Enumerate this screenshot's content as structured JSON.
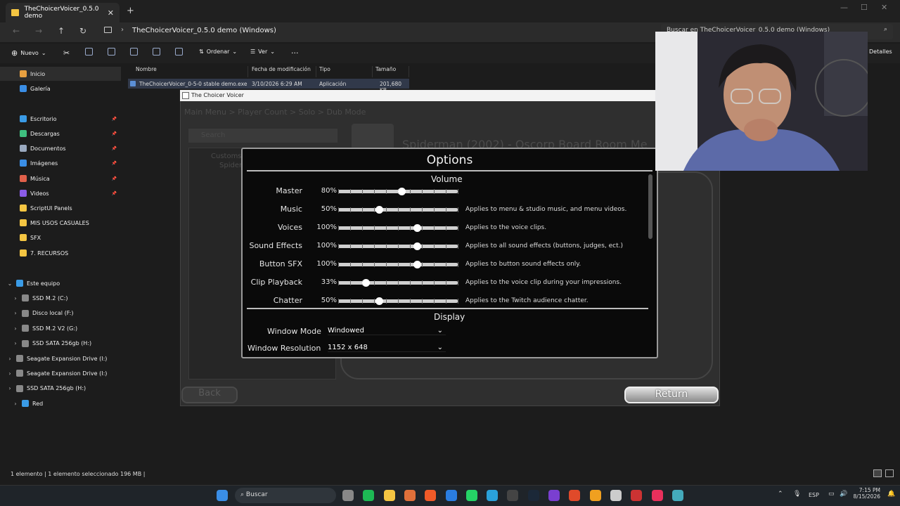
{
  "explorer": {
    "tab_title": "TheChoicerVoicer_0.5.0 demo",
    "breadcrumb": "TheChoicerVoicer_0.5.0 demo (Windows)",
    "search_placeholder": "Buscar en TheChoicerVoicer_0.5.0 demo (Windows)",
    "toolbar": {
      "new": "Nuevo",
      "sort": "Ordenar",
      "view": "Ver",
      "more": "···",
      "details": "Detalles"
    },
    "columns": [
      "Nombre",
      "Fecha de modificación",
      "Tipo",
      "Tamaño"
    ],
    "file": {
      "name": "TheChoicerVoicer_0-5-0 stable demo.exe",
      "date": "3/10/2026 6:29 AM",
      "type": "Aplicación",
      "size": "201,680 KB"
    },
    "sidebar": [
      {
        "label": "Inicio",
        "color": "#e8a040",
        "selected": true
      },
      {
        "label": "Galería",
        "color": "#3a8ee6"
      },
      {
        "label": "Escritorio",
        "color": "#3a9be6",
        "pin": true
      },
      {
        "label": "Descargas",
        "color": "#3fbf7f",
        "pin": true
      },
      {
        "label": "Documentos",
        "color": "#9aa9bf",
        "pin": true
      },
      {
        "label": "Imágenes",
        "color": "#3a8ee6",
        "pin": true
      },
      {
        "label": "Música",
        "color": "#e0604a",
        "pin": true
      },
      {
        "label": "Videos",
        "color": "#8a5be6",
        "pin": true
      },
      {
        "label": "ScriptUI Panels",
        "color": "#f4c542"
      },
      {
        "label": "MIS USOS CASUALES",
        "color": "#f4c542"
      },
      {
        "label": "SFX",
        "color": "#f4c542"
      },
      {
        "label": "7. RECURSOS",
        "color": "#f4c542"
      }
    ],
    "drives": [
      {
        "label": "Este equipo",
        "color": "#3a9be6",
        "expanded": true
      },
      {
        "label": "SSD M.2 (C:)",
        "color": "#888"
      },
      {
        "label": "Disco local (F:)",
        "color": "#888"
      },
      {
        "label": "SSD M.2 V2 (G:)",
        "color": "#888"
      },
      {
        "label": "SSD SATA 256gb (H:)",
        "color": "#888"
      },
      {
        "label": "Seagate Expansion Drive (I:)",
        "color": "#888"
      },
      {
        "label": "Seagate Expansion Drive (I:)",
        "color": "#888"
      },
      {
        "label": "SSD SATA 256gb (H:)",
        "color": "#888"
      },
      {
        "label": "Red",
        "color": "#3a9be6"
      }
    ],
    "status": "1 elemento    |  1 elemento seleccionado  196 MB  |"
  },
  "game": {
    "window_title": "The Choicer Voicer",
    "breadcrumb_dim": "Main Menu > Player Count > Solo > Dub Mode",
    "search_dim": "Search",
    "tree_dim": "Customs",
    "tree_sub_dim": "Spider",
    "bg_title_dim": "Spiderman (2002) - Oscorp Board Room Me",
    "back": "Back",
    "return": "Return",
    "options": {
      "title": "Options",
      "volume_header": "Volume",
      "display_header": "Display",
      "sliders": [
        {
          "label": "Master",
          "pct": "80%",
          "value": 0.53,
          "desc": ""
        },
        {
          "label": "Music",
          "pct": "50%",
          "value": 0.34,
          "desc": "Applies to menu & studio music, and menu videos."
        },
        {
          "label": "Voices",
          "pct": "100%",
          "value": 0.66,
          "desc": "Applies to the voice clips."
        },
        {
          "label": "Sound Effects",
          "pct": "100%",
          "value": 0.66,
          "desc": "Applies to all sound effects (buttons, judges, ect.)"
        },
        {
          "label": "Button SFX",
          "pct": "100%",
          "value": 0.66,
          "desc": "Applies to button sound effects only."
        },
        {
          "label": "Clip Playback",
          "pct": "33%",
          "value": 0.23,
          "desc": "Applies to the voice clip during your impressions."
        },
        {
          "label": "Chatter",
          "pct": "50%",
          "value": 0.34,
          "desc": "Applies to the Twitch audience chatter."
        }
      ],
      "window_mode_label": "Window Mode",
      "window_mode_value": "Windowed",
      "resolution_label": "Window Resolution",
      "resolution_value": "1152 x 648"
    }
  },
  "taskbar": {
    "search": "Buscar",
    "lang": "ESP",
    "time": "7:15 PM",
    "date": "8/15/2026"
  }
}
